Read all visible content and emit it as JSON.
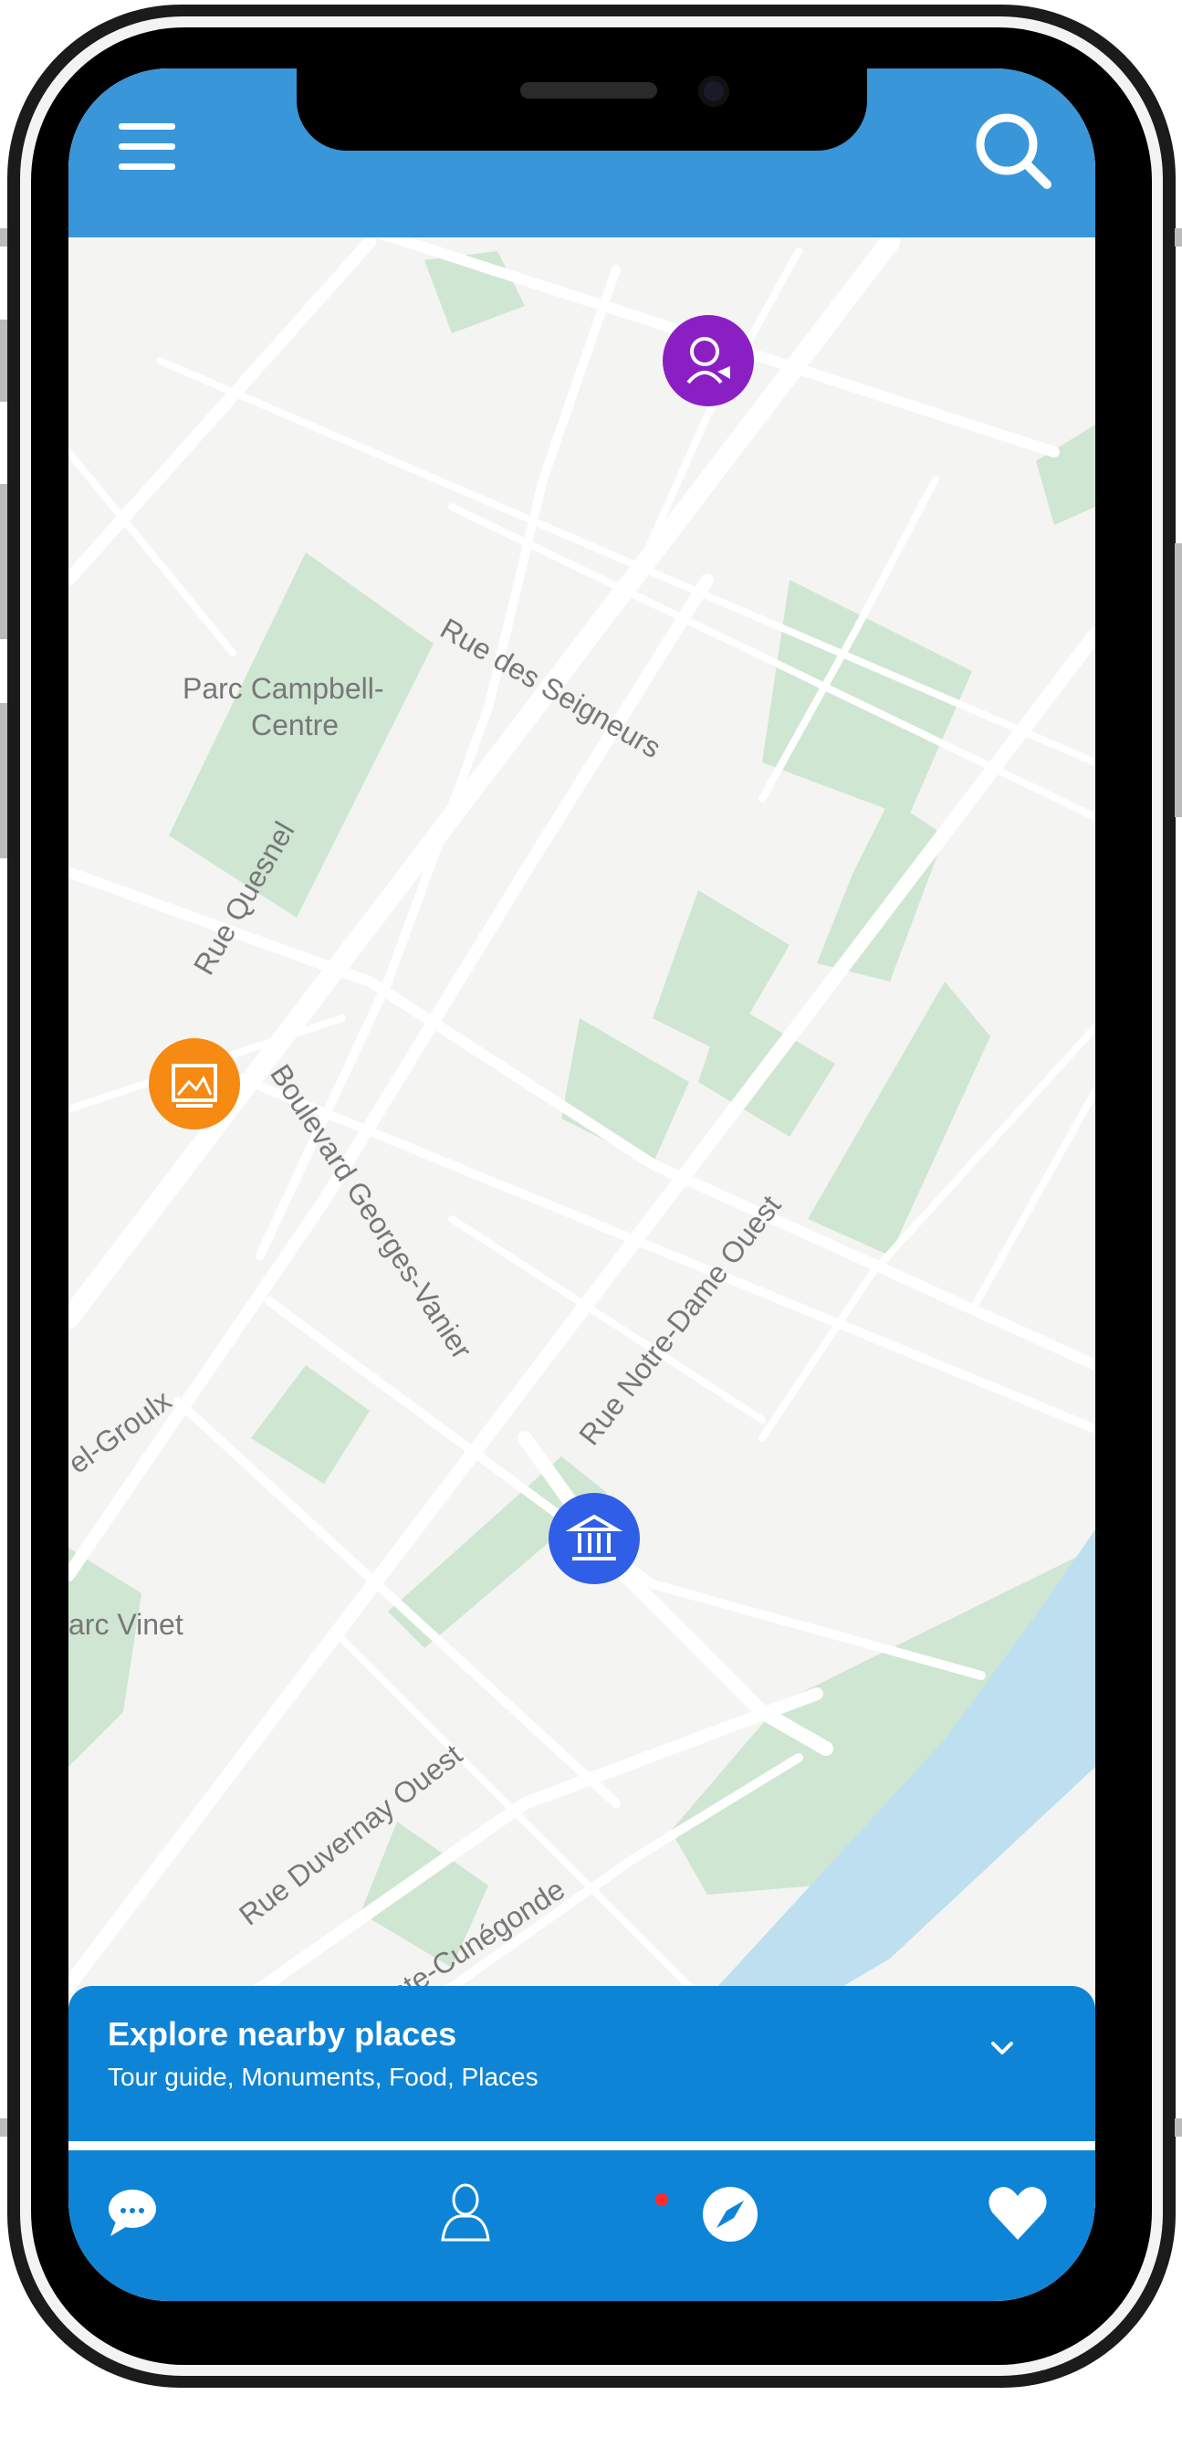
{
  "map": {
    "labels": {
      "parc_campbell_1": "Parc Campbell-",
      "parc_campbell_2": "Centre",
      "rue_seigneurs": "Rue des Seigneurs",
      "rue_quesnel": "Rue Quesnel",
      "blvd_georges_vanier": "Boulevard Georges-Vanier",
      "rue_notre_dame": "Rue Notre-Dame Ouest",
      "groulx": "el-Groulx",
      "parc_vinet": "arc Vinet",
      "rue_duvernay": "Rue Duvernay Ouest",
      "sainte_cunegonde": "e Sainte-Cunégonde"
    },
    "pins": [
      {
        "kind": "tour-guide",
        "color": "#8a1fc4"
      },
      {
        "kind": "art-gallery",
        "color": "#f68a12"
      },
      {
        "kind": "monument",
        "color": "#2f5fe6"
      }
    ]
  },
  "sheet": {
    "title": "Explore nearby places",
    "subtitle": "Tour guide, Monuments,  Food, Places"
  },
  "tabs": [
    "chat",
    "profile",
    "explore",
    "favorites"
  ],
  "active_tab": "explore",
  "colors": {
    "header": "#3896d9",
    "sheet": "#0e84d6",
    "park": "#cfe6d2",
    "water": "#bddff0",
    "road": "#ffffff",
    "active_dot": "#ff2a2a"
  }
}
